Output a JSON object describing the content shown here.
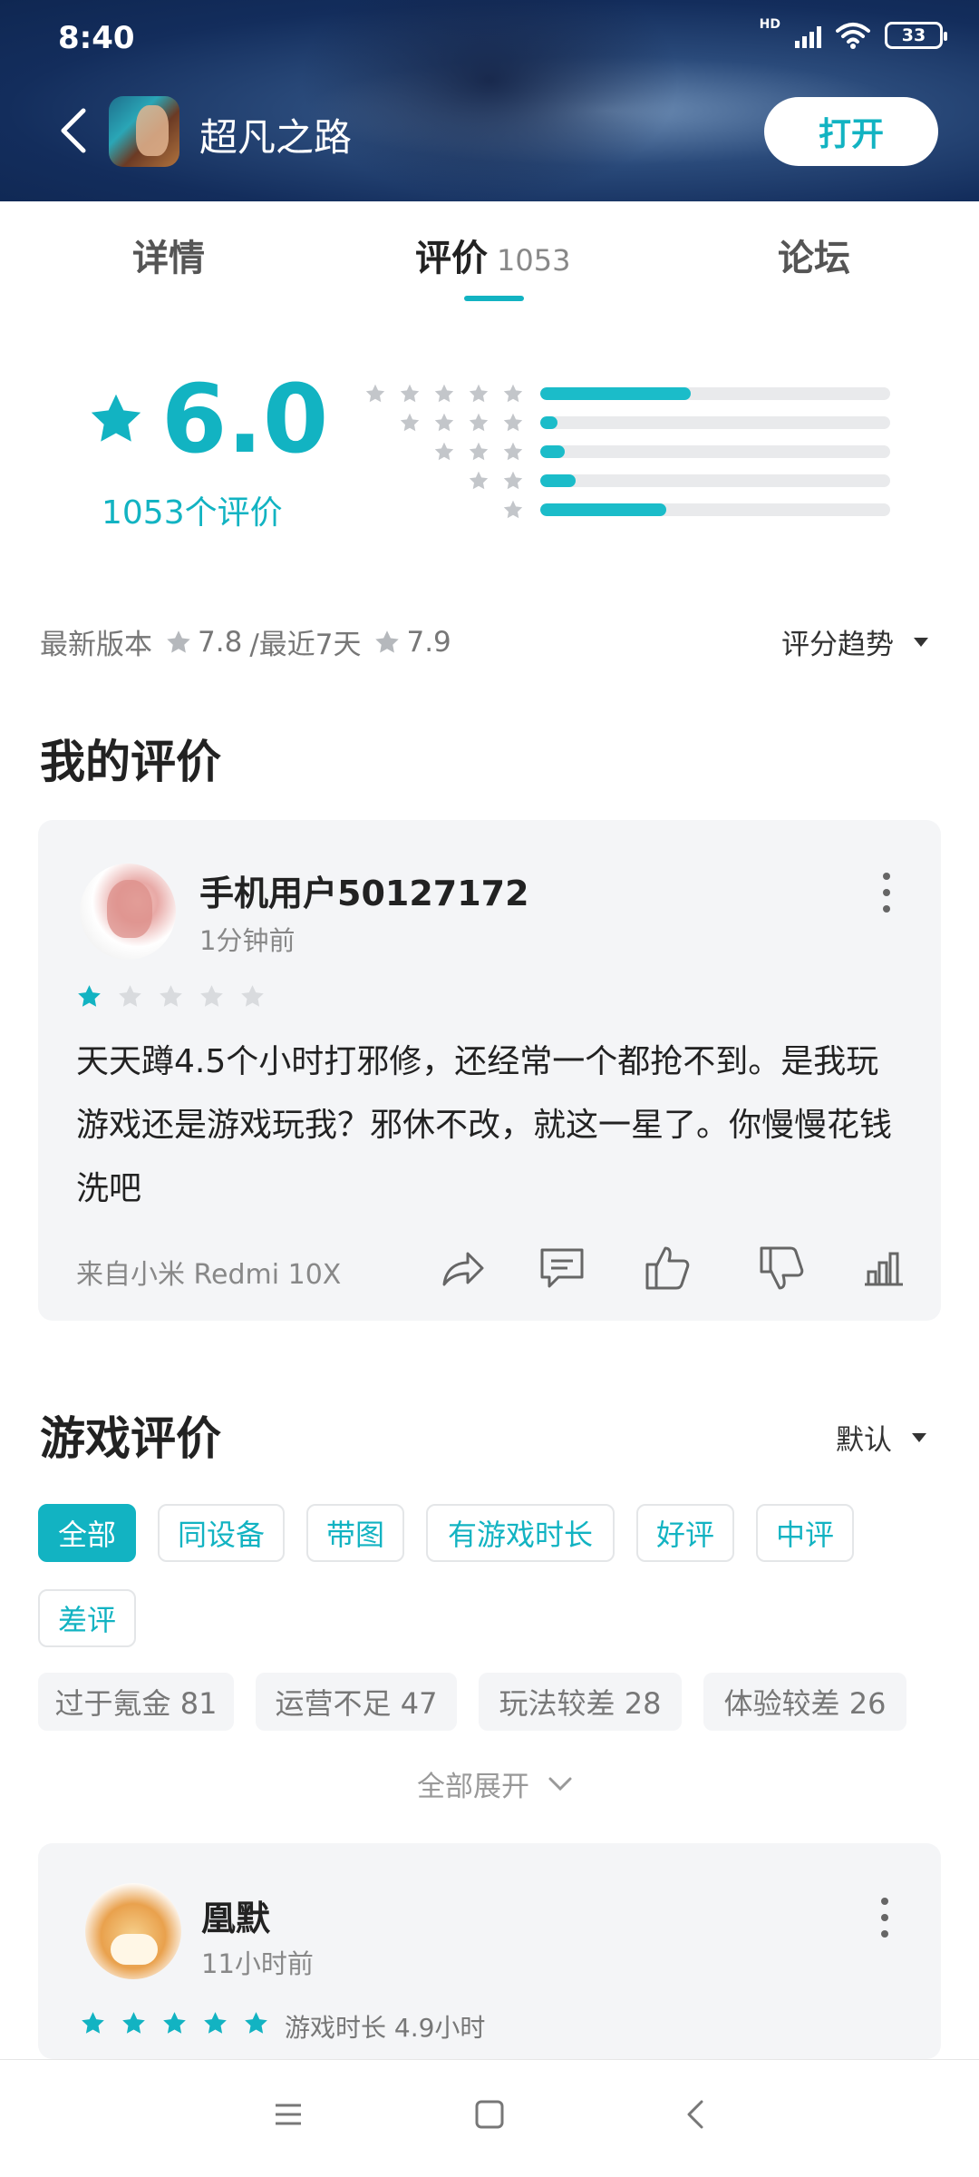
{
  "status_bar": {
    "time": "8:40",
    "network_label": "HD",
    "battery": "33"
  },
  "header": {
    "app_title": "超凡之路",
    "open_button": "打开"
  },
  "tabs": [
    {
      "label": "详情",
      "active": false
    },
    {
      "label": "评价",
      "count": "1053",
      "active": true
    },
    {
      "label": "论坛",
      "active": false
    }
  ],
  "rating": {
    "score": "6.0",
    "count_label": "1053个评价",
    "distribution": [
      {
        "stars": 5,
        "fraction": 0.43
      },
      {
        "stars": 4,
        "fraction": 0.05
      },
      {
        "stars": 3,
        "fraction": 0.07
      },
      {
        "stars": 2,
        "fraction": 0.1
      },
      {
        "stars": 1,
        "fraction": 0.36
      }
    ],
    "latest_version_label": "最新版本",
    "latest_version_score": "7.8",
    "recent_label": "/最近7天",
    "recent_score": "7.9",
    "trend_label": "评分趋势"
  },
  "my_review": {
    "section_title": "我的评价",
    "username": "手机用户50127172",
    "time": "1分钟前",
    "stars": 1,
    "text": "天天蹲4.5个小时打邪修，还经常一个都抢不到。是我玩游戏还是游戏玩我？邪休不改，就这一星了。你慢慢花钱洗吧",
    "device": "来自小米 Redmi 10X"
  },
  "game_reviews": {
    "section_title": "游戏评价",
    "sort_label": "默认",
    "filters": [
      "全部",
      "同设备",
      "带图",
      "有游戏时长",
      "好评",
      "中评",
      "差评"
    ],
    "tags": [
      "过于氪金 81",
      "运营不足 47",
      "玩法较差 28",
      "体验较差 26"
    ],
    "expand_label": "全部展开"
  },
  "first_review": {
    "username": "凰默",
    "time": "11小时前",
    "stars": 5,
    "playtime": "游戏时长 4.9小时"
  },
  "colors": {
    "accent": "#12b3c2",
    "bar_fill": "#1bbcc9",
    "bar_track": "#e9eaec",
    "card_bg": "#f4f5f7"
  }
}
